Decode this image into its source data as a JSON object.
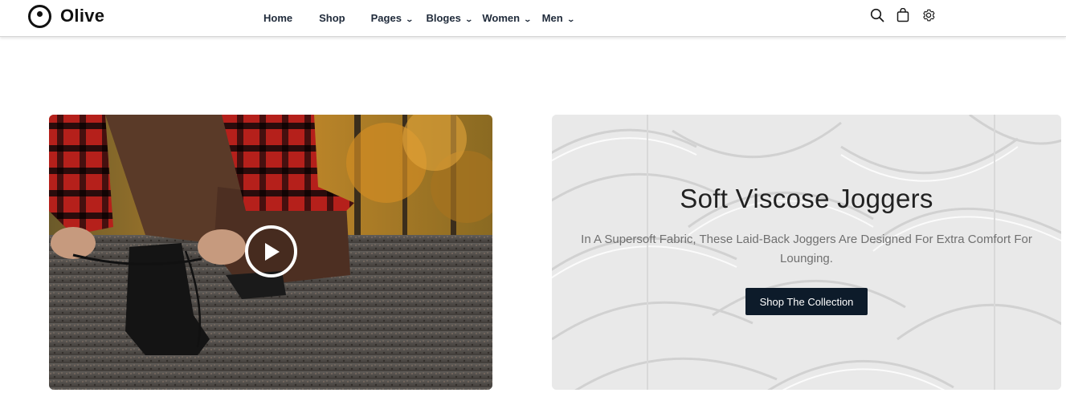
{
  "brand": {
    "name": "Olive",
    "icon": "olive-logo-icon"
  },
  "nav": {
    "items": [
      {
        "label": "Home",
        "has_dropdown": false
      },
      {
        "label": "Shop",
        "has_dropdown": false
      },
      {
        "label": "Pages",
        "has_dropdown": true
      },
      {
        "label": "Bloges",
        "has_dropdown": true
      },
      {
        "label": "Women",
        "has_dropdown": true
      },
      {
        "label": "Men",
        "has_dropdown": true
      }
    ]
  },
  "header_icons": [
    "search-icon",
    "shopping-bag-icon",
    "gear-icon"
  ],
  "video": {
    "icon": "play-icon"
  },
  "promo": {
    "title": "Soft Viscose Joggers",
    "description": "In A Supersoft Fabric, These Laid-Back Joggers Are Designed For Extra Comfort For Lounging.",
    "button_label": "Shop The Collection"
  },
  "colors": {
    "button_bg": "#0d1b2a",
    "text_dark": "#222222",
    "text_muted": "#707070"
  }
}
